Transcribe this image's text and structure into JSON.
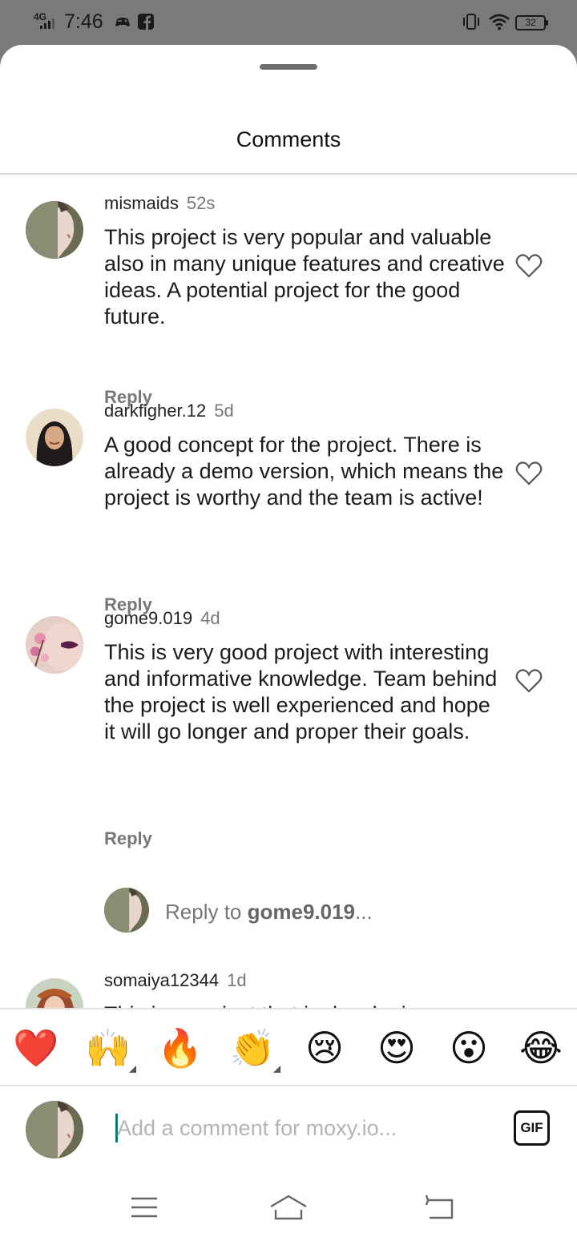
{
  "status_bar": {
    "network": "4G",
    "time": "7:46",
    "battery": "32"
  },
  "sheet": {
    "title": "Comments"
  },
  "comments": [
    {
      "username": "mismaids",
      "time": "52s",
      "text": "This project is very popular and valuable also in many unique features and creative ideas. A potential project for the good future.",
      "reply_label": "Reply"
    },
    {
      "username": "darkfigher.12",
      "time": "5d",
      "text": "A good concept for the project. There is already a demo version, which means the project is worthy and the team is active!",
      "reply_label": "Reply"
    },
    {
      "username": "gome9.019",
      "time": "4d",
      "text": "This is very good project with interesting and informative knowledge. Team behind the project is well experienced and hope it will go longer and proper their goals.",
      "reply_label": "Reply"
    },
    {
      "username": "somaiya12344",
      "time": "1d",
      "text": "This is a project that is developing very strongly the crypto network, it"
    }
  ],
  "reply_prompt": {
    "prefix": "Reply to ",
    "target": "gome9.019",
    "suffix": "..."
  },
  "emoji_bar": [
    "❤️",
    "🙌",
    "🔥",
    "👏",
    "😢",
    "😍",
    "😮",
    "😂"
  ],
  "composer": {
    "placeholder": "Add a comment for moxy.io...",
    "value": "",
    "gif_label": "GIF"
  },
  "colors": {
    "accent": "#0b7a6b",
    "muted": "#777777",
    "divider": "#dcdcdc",
    "statusbar": "#7a7a7a"
  }
}
